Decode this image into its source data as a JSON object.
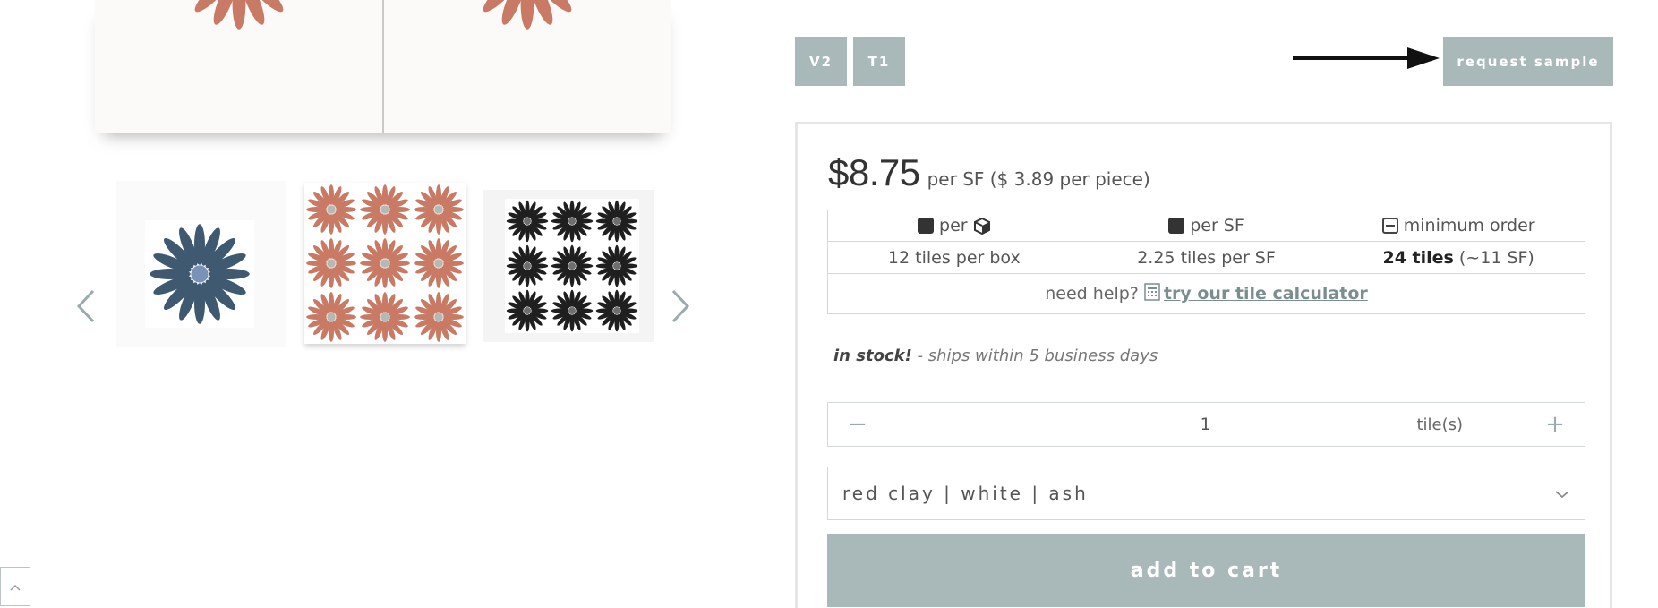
{
  "gallery": {
    "main_image_icon": "tile-pattern-image",
    "prev_icon": "chevron-left-icon",
    "next_icon": "chevron-right-icon",
    "thumbnails": [
      {
        "name": "blue-tile-thumbnail",
        "colors": [
          "#3f5a70",
          "#ffffff",
          "#7a92b8"
        ]
      },
      {
        "name": "red-clay-tile-thumbnail",
        "colors": [
          "#c97a64",
          "#ffffff",
          "#b5b9b5"
        ]
      },
      {
        "name": "black-tile-thumbnail",
        "colors": [
          "#1f1f1f",
          "#ffffff",
          "#6e6e6e"
        ]
      }
    ],
    "back_to_top_icon": "chevron-up-icon"
  },
  "variants": [
    "V2",
    "T1"
  ],
  "sample_button": "request sample",
  "price": {
    "amount": "$8.75",
    "unit": "per SF ($ 3.89 per piece)"
  },
  "specs": {
    "headers": [
      {
        "icon": "square-icon",
        "label": "per",
        "trailing_icon": "box-icon"
      },
      {
        "icon": "square-icon",
        "label": "per SF"
      },
      {
        "icon": "minus-square-icon",
        "label": "minimum order"
      }
    ],
    "values": [
      {
        "text": "12 tiles per box"
      },
      {
        "text": "2.25 tiles per SF"
      },
      {
        "bold": "24 tiles",
        "text": " (~11 SF)"
      }
    ]
  },
  "help": {
    "prefix": "need help?",
    "icon": "calculator-icon",
    "link": "try our tile calculator"
  },
  "stock": {
    "status": "in stock!",
    "detail": " - ships within 5 business days"
  },
  "quantity": {
    "value": "1",
    "unit": "tile(s)",
    "minus": "−",
    "plus": "+"
  },
  "color_select": {
    "value": "red clay | white | ash",
    "icon": "chevron-down-icon"
  },
  "add_to_cart": "add to cart",
  "colors": {
    "accent": "#a9b8b9",
    "link": "#7a8e8f",
    "clay": "#c97a64"
  }
}
